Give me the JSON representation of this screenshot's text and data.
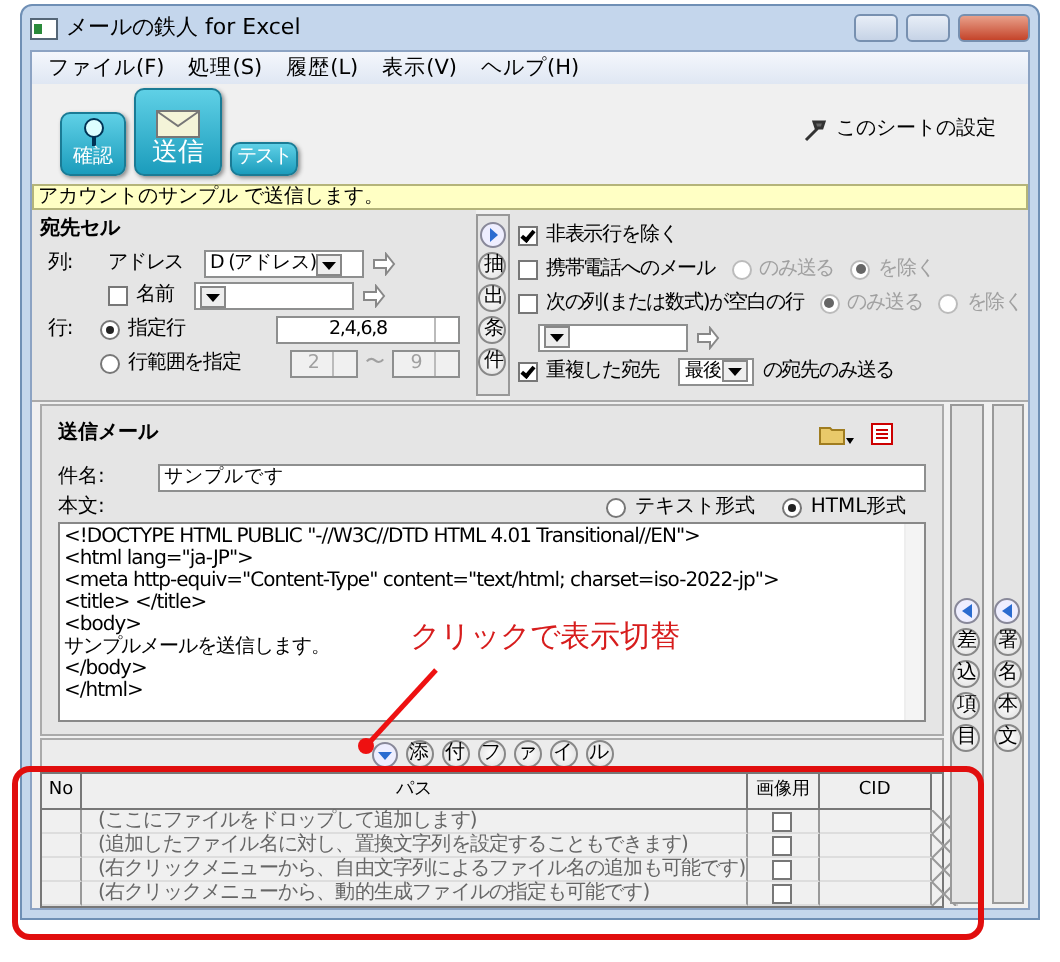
{
  "window": {
    "title": "メールの鉄人 for Excel"
  },
  "menu": [
    "ファイル(F)",
    "処理(S)",
    "履歴(L)",
    "表示(V)",
    "ヘルプ(H)"
  ],
  "toolbar": {
    "buttons": [
      {
        "kind": "confirm",
        "label": "確認"
      },
      {
        "kind": "send",
        "label": "送信"
      },
      {
        "kind": "test",
        "label": "テスト"
      }
    ],
    "sheet_settings": "このシートの設定"
  },
  "status_bar": "アカウントのサンプル で送信します。",
  "recipient_cells": {
    "title": "宛先セル",
    "column_label": "列:",
    "address_label": "アドレス",
    "address_value": "D (アドレス)",
    "name_checkbox": {
      "label": "名前",
      "checked": false
    },
    "row_label": "行:",
    "row_options": [
      {
        "label": "指定行",
        "selected": true
      },
      {
        "label": "行範囲を指定",
        "selected": false
      }
    ],
    "specified_rows": "2,4,6,8",
    "range_from": "2",
    "range_separator": "〜",
    "range_to": "9"
  },
  "filter_tab": {
    "label": "抽出条件"
  },
  "filters": [
    {
      "kind": "check",
      "label": "非表示行を除く",
      "checked": true
    },
    {
      "kind": "radios",
      "label": "携帯電話へのメール",
      "checked": false,
      "options": [
        {
          "label": "のみ送る",
          "selected": false,
          "disabled": true
        },
        {
          "label": "を除く",
          "selected": true,
          "disabled": true
        }
      ]
    },
    {
      "kind": "radios",
      "label": "次の列(または数式)が空白の行",
      "checked": false,
      "options": [
        {
          "label": "のみ送る",
          "selected": true,
          "disabled": true
        },
        {
          "label": "を除く",
          "selected": false,
          "disabled": true
        }
      ]
    },
    {
      "kind": "dropdown"
    },
    {
      "kind": "select",
      "label": "重複した宛先",
      "checked": true,
      "value": "最後",
      "suffix": "の宛先のみ送る"
    }
  ],
  "mail": {
    "title": "送信メール",
    "subject_label": "件名:",
    "subject": "サンプルです",
    "body_label": "本文:",
    "formats": [
      {
        "label": "テキスト形式",
        "selected": false
      },
      {
        "label": "HTML形式",
        "selected": true
      }
    ],
    "body": "<!DOCTYPE HTML PUBLIC \"-//W3C//DTD HTML 4.01 Transitional//EN\">\n<html lang=\"ja-JP\">\n<meta http-equiv=\"Content-Type\" content=\"text/html; charset=iso-2022-jp\">\n<title> </title>\n<body>\nサンプルメールを送信します。\n</body>\n</html>"
  },
  "side_tabs": [
    {
      "label": "差込項目"
    },
    {
      "label": "署名本文"
    }
  ],
  "attachments": {
    "toggle_label": "添付ファイル",
    "columns": [
      "No",
      "パス",
      "画像用",
      "CID"
    ],
    "rows": [
      {
        "path": "(ここにファイルをドロップして追加します)",
        "image": false
      },
      {
        "path": "(追加したファイル名に対し、置換文字列を設定することもできます)",
        "image": false
      },
      {
        "path": "(右クリックメニューから、自由文字列によるファイル名の追加も可能です)",
        "image": false
      },
      {
        "path": "(右クリックメニューから、動的生成ファイルの指定も可能です)",
        "image": false
      }
    ]
  },
  "annotation": {
    "text": "クリックで表示切替"
  }
}
